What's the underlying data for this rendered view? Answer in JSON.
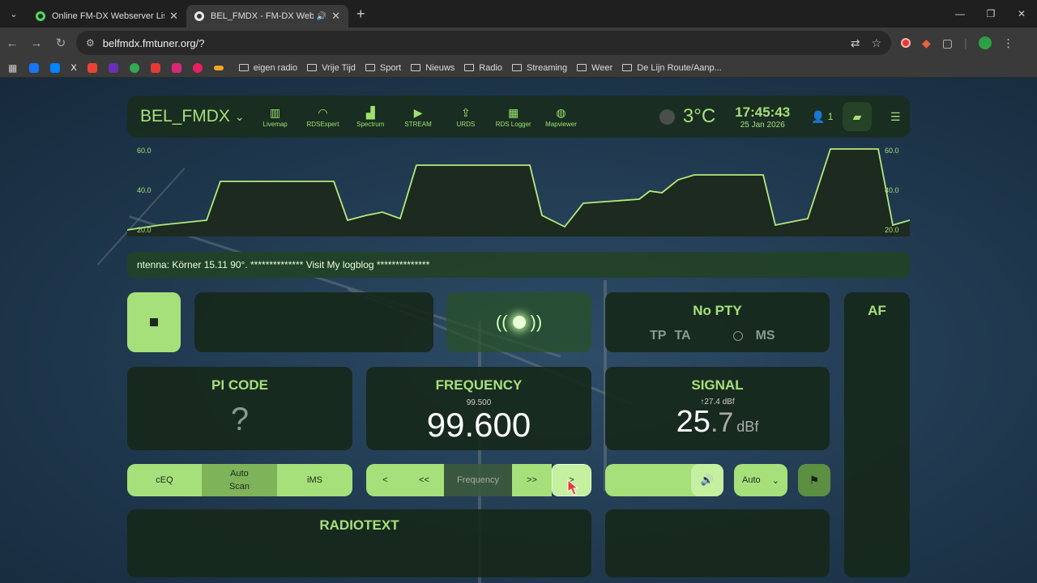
{
  "browser": {
    "tabs": [
      {
        "title": "Online FM-DX Webserver List"
      },
      {
        "title": "BEL_FMDX - FM-DX Webserver"
      }
    ],
    "url": "belfmdx.fmtuner.org/?",
    "bookmarks": [
      "eigen radio",
      "Vrije Tijd",
      "Sport",
      "Nieuws",
      "Radio",
      "Streaming",
      "Weer",
      "De Lijn Route/Aanp..."
    ]
  },
  "header": {
    "station": "BEL_FMDX",
    "nav": [
      {
        "label": "Livemap",
        "icon": "map-icon"
      },
      {
        "label": "RDSExpert",
        "icon": "rss-icon"
      },
      {
        "label": "Spectrum",
        "icon": "chart-icon"
      },
      {
        "label": "STREAM",
        "icon": "play-icon"
      },
      {
        "label": "URDS",
        "icon": "upload-icon"
      },
      {
        "label": "RDS Logger",
        "icon": "table-icon"
      },
      {
        "label": "Mapviewer",
        "icon": "globe-icon"
      }
    ],
    "temperature": "3°C",
    "time": "17:45:43",
    "date": "25 Jan 2026",
    "users": "1"
  },
  "graph": {
    "left_labels": [
      "60.0",
      "40.0",
      "20.0"
    ],
    "right_labels": [
      "60.0",
      "40.0",
      "20.0"
    ],
    "colors": {
      "line": "#b4ea7a",
      "fill": "#1c2a1f"
    }
  },
  "ticker": {
    "text": "ntenna: Körner 15.11 90°. ************** Visit My logblog **************"
  },
  "rds": {
    "pty": "No PTY",
    "tp": "TP",
    "ta": "TA",
    "ms": "MS",
    "af_title": "AF"
  },
  "pi": {
    "title": "PI CODE",
    "value": "?"
  },
  "frequency": {
    "title": "FREQUENCY",
    "previous": "99.500",
    "value": "99.600"
  },
  "signal": {
    "title": "SIGNAL",
    "peak": "27.4 dBf",
    "int": "25",
    "dec": ".7",
    "unit": "dBf"
  },
  "controls": {
    "ceq": "cEQ",
    "autoscan_1": "Auto",
    "autoscan_2": "Scan",
    "ims": "iMS",
    "prev": "<",
    "prev_fast": "<<",
    "freq_placeholder": "Frequency",
    "next_fast": ">>",
    "next": ">",
    "auto_select": "Auto"
  },
  "radiotext": {
    "title": "RADIOTEXT"
  },
  "colors": {
    "accent": "#a6e07a",
    "panel": "#16281a"
  }
}
